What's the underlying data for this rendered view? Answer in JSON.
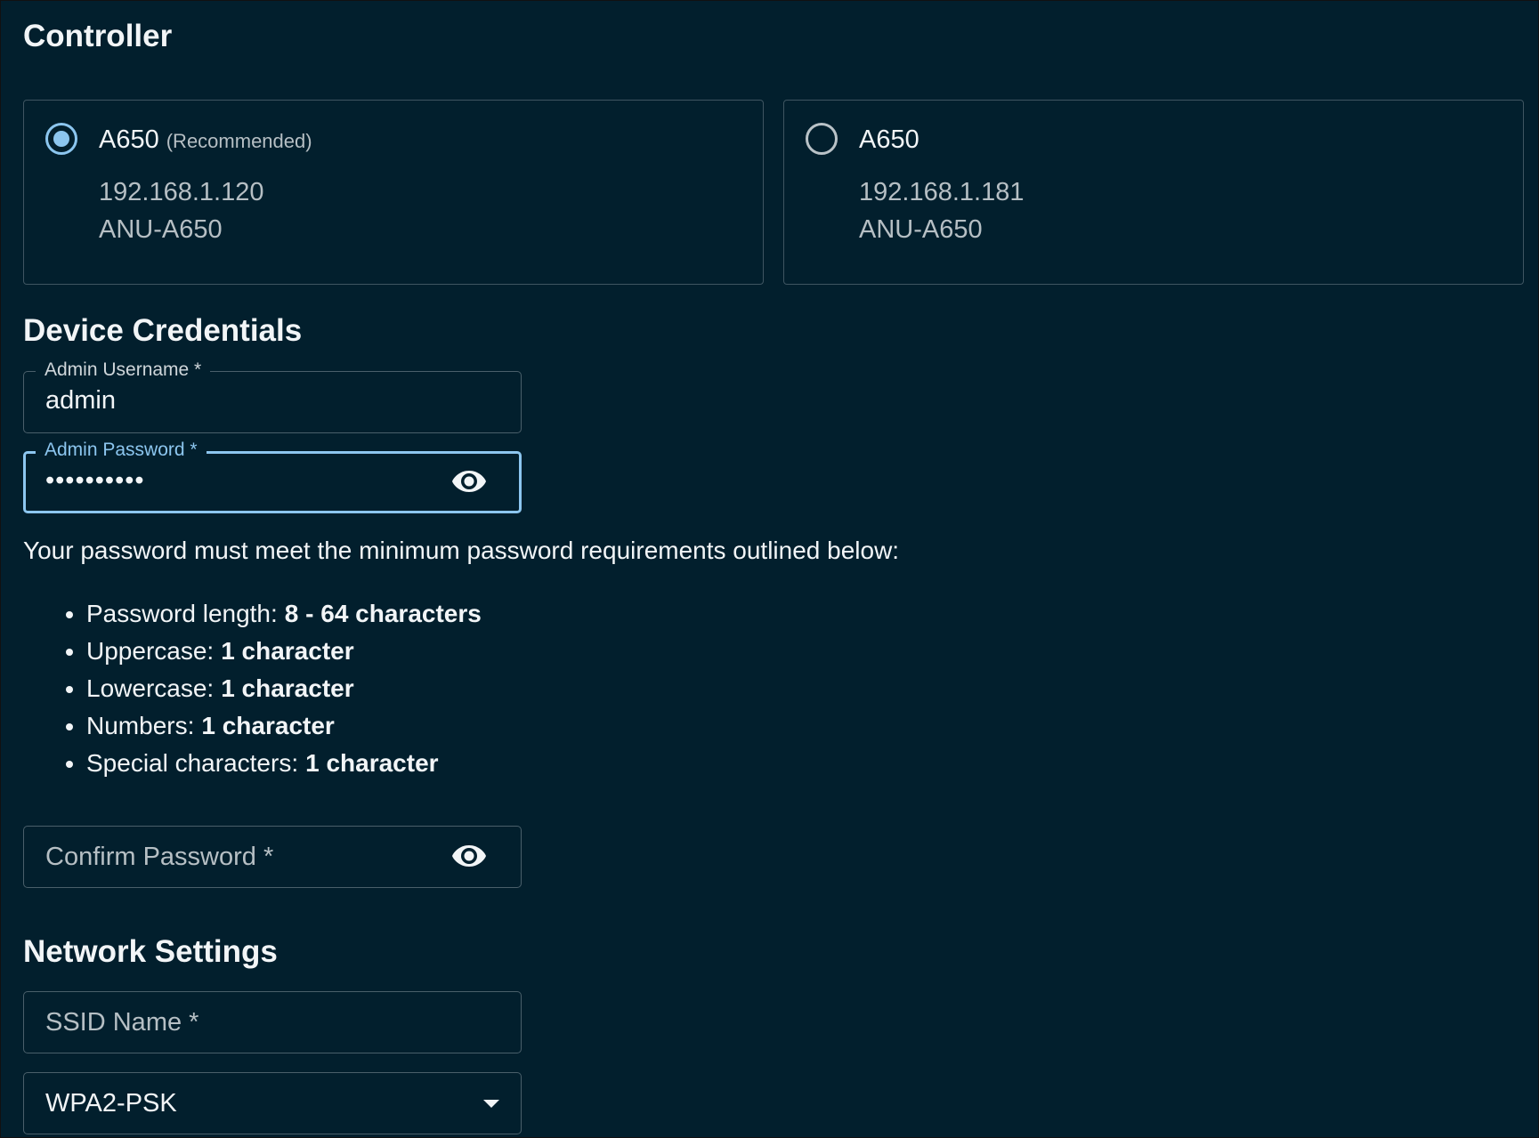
{
  "controller": {
    "title": "Controller",
    "options": [
      {
        "name": "A650",
        "tag": "(Recommended)",
        "ip": "192.168.1.120",
        "hostname": "ANU-A650",
        "selected": true
      },
      {
        "name": "A650",
        "tag": "",
        "ip": "192.168.1.181",
        "hostname": "ANU-A650",
        "selected": false
      }
    ]
  },
  "credentials": {
    "title": "Device Credentials",
    "username_label": "Admin Username *",
    "username_value": "admin",
    "password_label": "Admin Password *",
    "password_value": "••••••••••",
    "password_hint": "Your password must meet the minimum password requirements outlined below:",
    "requirements": [
      {
        "label": "Password length:",
        "value": "8 - 64 characters"
      },
      {
        "label": "Uppercase:",
        "value": "1 character"
      },
      {
        "label": "Lowercase:",
        "value": "1 character"
      },
      {
        "label": "Numbers:",
        "value": "1 character"
      },
      {
        "label": "Special characters:",
        "value": "1 character"
      }
    ],
    "confirm_placeholder": "Confirm Password *"
  },
  "network": {
    "title": "Network Settings",
    "ssid_placeholder": "SSID Name *",
    "security_value": "WPA2-PSK"
  },
  "colors": {
    "background": "#021f2d",
    "accent": "#8cc6ef",
    "border": "#4a5f6a",
    "muted_text": "#b6bfc4"
  },
  "icons": {
    "visibility": "eye-icon",
    "dropdown": "chevron-down-icon"
  }
}
